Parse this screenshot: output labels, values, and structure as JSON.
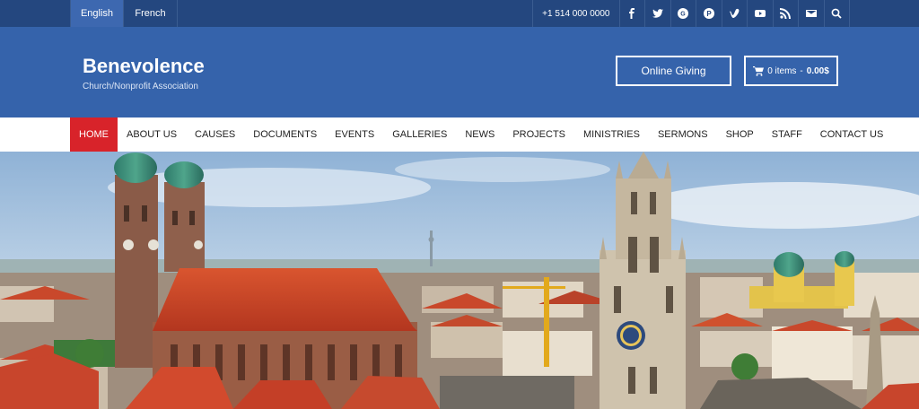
{
  "topbar": {
    "languages": [
      "English",
      "French"
    ],
    "phone": "+1 514 000 0000",
    "social_icons": [
      "facebook-icon",
      "twitter-icon",
      "google-plus-icon",
      "pinterest-icon",
      "vimeo-icon",
      "youtube-icon",
      "rss-icon",
      "email-icon",
      "search-icon"
    ]
  },
  "header": {
    "site_name": "Benevolence",
    "tagline": "Church/Nonprofit Association",
    "give_label": "Online Giving",
    "cart_items": "0 items",
    "cart_sep": " - ",
    "cart_total": "0.00$"
  },
  "nav": {
    "items": [
      "HOME",
      "ABOUT US",
      "CAUSES",
      "DOCUMENTS",
      "EVENTS",
      "GALLERIES",
      "NEWS",
      "PROJECTS",
      "MINISTRIES",
      "SERMONS",
      "SHOP",
      "STAFF",
      "CONTACT US"
    ],
    "active": "HOME"
  },
  "colors": {
    "topbar": "#24477f",
    "header": "#3563ab",
    "active_nav": "#d8232a",
    "roof": "#c8452c"
  }
}
